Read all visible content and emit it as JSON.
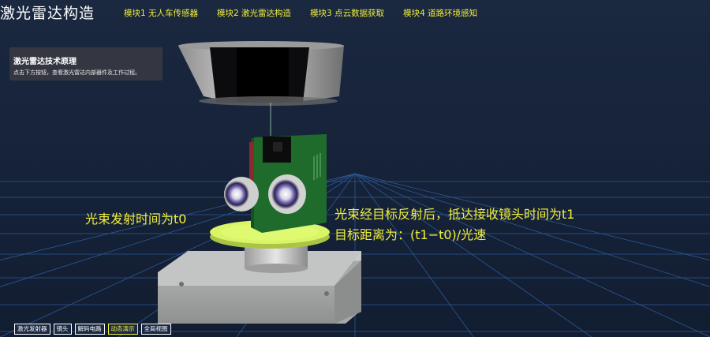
{
  "app": {
    "title": "激光雷达构造"
  },
  "nav": {
    "items": [
      {
        "label": "模块1 无人车传感器"
      },
      {
        "label": "模块2 激光雷达构造"
      },
      {
        "label": "模块3 点云数据获取"
      },
      {
        "label": "模块4 道路环境感知"
      }
    ]
  },
  "info_panel": {
    "title": "激光雷达技术原理",
    "description": "点击下方按钮，查看激光雷达内部器件及工作过程。"
  },
  "annotations": {
    "emit_time": "光束发射时间为t0",
    "receive_time": "光束经目标反射后，抵达接收镜头时间为t1",
    "distance_formula": "目标距离为：(t1−t0)/光速"
  },
  "toolbar": {
    "buttons": [
      {
        "label": "激光发射器",
        "active": false
      },
      {
        "label": "镜头",
        "active": false
      },
      {
        "label": "解码电路",
        "active": false
      },
      {
        "label": "动态演示",
        "active": true
      },
      {
        "label": "全局视图",
        "active": false
      }
    ]
  },
  "colors": {
    "background": "#15223a",
    "grid": "#2f63a8",
    "accent_text": "#f2ee3a",
    "pcb_green": "#1f6b2c",
    "turntable_green": "#d9f566"
  }
}
